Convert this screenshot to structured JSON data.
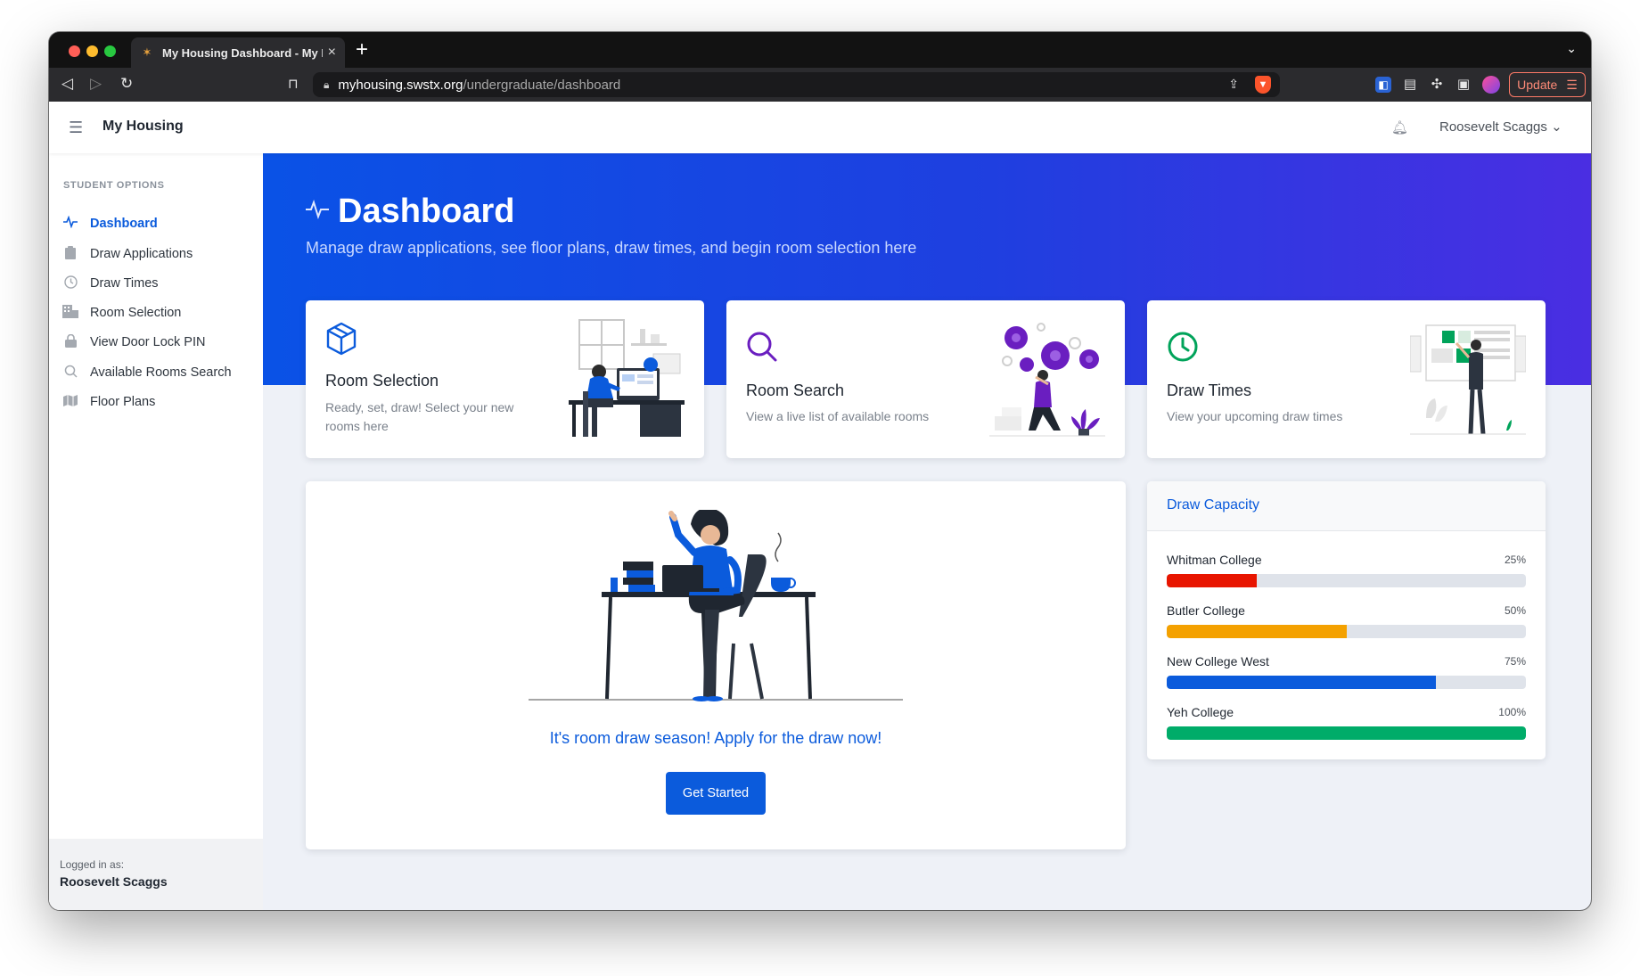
{
  "browser": {
    "tab_title": "My Housing Dashboard - My Ho",
    "tab_close": "×",
    "new_tab": "+",
    "url_host": "myhousing.swstx.org",
    "url_path": "/undergraduate/dashboard",
    "update_label": "Update"
  },
  "header": {
    "brand": "My Housing",
    "user_name": "Roosevelt Scaggs",
    "user_caret": "⌄"
  },
  "sidebar": {
    "heading": "STUDENT OPTIONS",
    "items": [
      {
        "label": "Dashboard",
        "icon": "activity-icon"
      },
      {
        "label": "Draw Applications",
        "icon": "clipboard-icon"
      },
      {
        "label": "Draw Times",
        "icon": "clock-icon"
      },
      {
        "label": "Room Selection",
        "icon": "building-icon"
      },
      {
        "label": "View Door Lock PIN",
        "icon": "lock-icon"
      },
      {
        "label": "Available Rooms Search",
        "icon": "search-icon"
      },
      {
        "label": "Floor Plans",
        "icon": "map-icon"
      }
    ],
    "footer": {
      "logged_label": "Logged in as:",
      "logged_name": "Roosevelt Scaggs"
    }
  },
  "hero": {
    "title": "Dashboard",
    "subtitle": "Manage draw applications, see floor plans, draw times, and begin room selection here"
  },
  "cards": [
    {
      "title": "Room Selection",
      "desc": "Ready, set, draw! Select your new rooms here",
      "icon": "box-icon",
      "color": "#0b5bdc"
    },
    {
      "title": "Room Search",
      "desc": "View a live list of available rooms",
      "icon": "search-icon",
      "color": "#6a1ec0"
    },
    {
      "title": "Draw Times",
      "desc": "View your upcoming draw times",
      "icon": "clock-icon",
      "color": "#00a35a"
    }
  ],
  "cta": {
    "text": "It's room draw season! Apply for the draw now!",
    "button": "Get Started"
  },
  "capacity": {
    "title": "Draw Capacity",
    "rows": [
      {
        "name": "Whitman College",
        "pct_label": "25%",
        "value": 0.25,
        "color": "#e81500"
      },
      {
        "name": "Butler College",
        "pct_label": "50%",
        "value": 0.5,
        "color": "#f4a100"
      },
      {
        "name": "New College West",
        "pct_label": "75%",
        "value": 0.75,
        "color": "#0b5bdc"
      },
      {
        "name": "Yeh College",
        "pct_label": "100%",
        "value": 1.0,
        "color": "#00ac69"
      }
    ]
  },
  "colors": {
    "primary": "#0b5bdc",
    "hero_start": "#0a52e6",
    "hero_end": "#4a2ee2"
  }
}
